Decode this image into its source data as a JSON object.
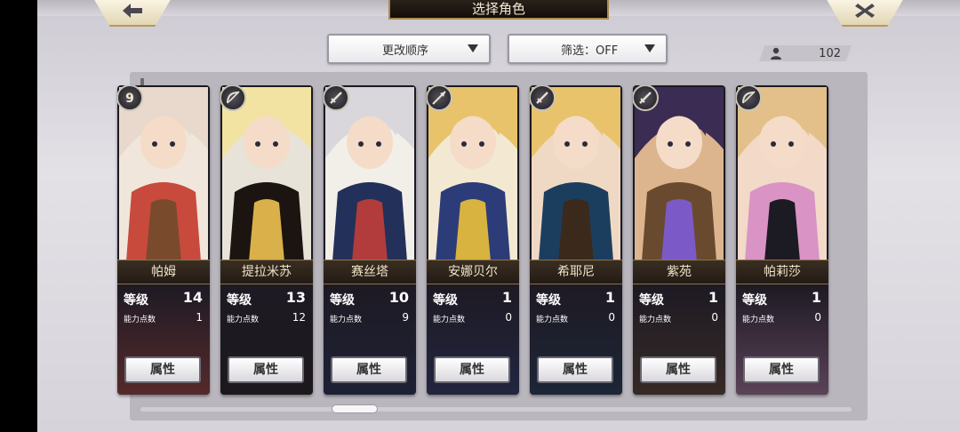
{
  "header": {
    "title": "选择角色",
    "back_icon": "arrow-left-icon",
    "close_icon": "close-x-icon"
  },
  "controls": {
    "sort_label": "更改顺序",
    "filter_label": "筛选：OFF",
    "character_count": "102",
    "count_icon": "user-icon"
  },
  "colors": {
    "name_bar": "#2d241b",
    "card_bg": "#1c1a22",
    "gold_border": "#b59a5a",
    "attr_button": "#ffffff"
  },
  "cards": [
    {
      "name": "帕姆",
      "level_label": "等级",
      "level": "14",
      "ap_label": "能力点数",
      "ap": "1",
      "attr_label": "属性",
      "class_icon": "rank-9-icon",
      "palette": [
        "#e8d9cc",
        "#c84a3d",
        "#7a4a2c",
        "#f0e6dc"
      ]
    },
    {
      "name": "提拉米苏",
      "level_label": "等级",
      "level": "13",
      "ap_label": "能力点数",
      "ap": "12",
      "attr_label": "属性",
      "class_icon": "bow-icon",
      "palette": [
        "#f3e3a2",
        "#1b1410",
        "#d9b04a",
        "#e8e3d8"
      ]
    },
    {
      "name": "赛丝塔",
      "level_label": "等级",
      "level": "10",
      "ap_label": "能力点数",
      "ap": "9",
      "attr_label": "属性",
      "class_icon": "sword-icon",
      "palette": [
        "#d9d6dc",
        "#23305a",
        "#b23c3c",
        "#f2efe9"
      ]
    },
    {
      "name": "安娜贝尔",
      "level_label": "等级",
      "level": "1",
      "ap_label": "能力点数",
      "ap": "0",
      "attr_label": "属性",
      "class_icon": "lance-icon",
      "palette": [
        "#e8c36b",
        "#2c3c78",
        "#d8b33f",
        "#f3e9d2"
      ]
    },
    {
      "name": "希耶尼",
      "level_label": "等级",
      "level": "1",
      "ap_label": "能力点数",
      "ap": "0",
      "attr_label": "属性",
      "class_icon": "sword-icon",
      "palette": [
        "#e8c36b",
        "#1c3e5e",
        "#3b2a1c",
        "#f0d9c4"
      ]
    },
    {
      "name": "紫苑",
      "level_label": "等级",
      "level": "1",
      "ap_label": "能力点数",
      "ap": "0",
      "attr_label": "属性",
      "class_icon": "sword-icon",
      "palette": [
        "#3a2c52",
        "#6a4a2e",
        "#7b5ac8",
        "#dcb58e"
      ]
    },
    {
      "name": "帕莉莎",
      "level_label": "等级",
      "level": "1",
      "ap_label": "能力点数",
      "ap": "0",
      "attr_label": "属性",
      "class_icon": "bow-icon",
      "palette": [
        "#e3c08a",
        "#d993c4",
        "#1c1a22",
        "#f2d9c8"
      ]
    }
  ]
}
